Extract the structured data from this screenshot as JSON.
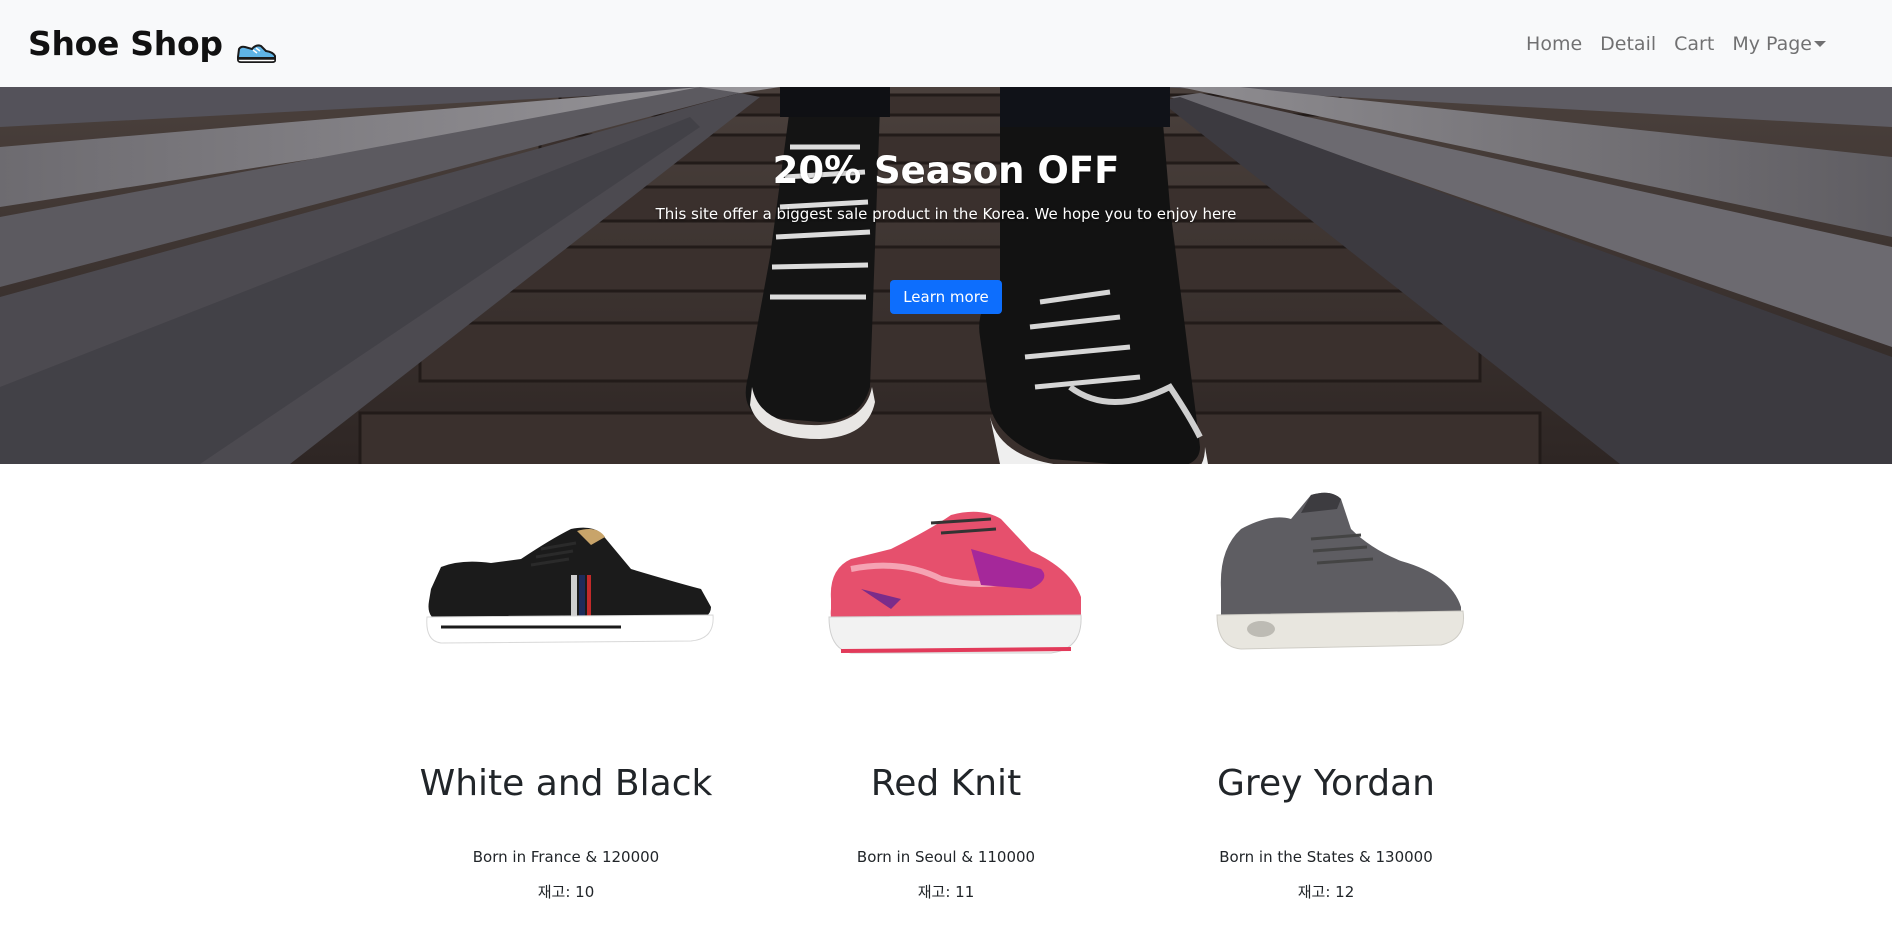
{
  "navbar": {
    "brand": "Shoe Shop",
    "brand_icon": "sneaker-icon",
    "links": [
      "Home",
      "Detail",
      "Cart"
    ],
    "dropdown_label": "My Page"
  },
  "hero": {
    "title": "20% Season OFF",
    "subtitle": "This site offer a biggest sale product in the Korea. We hope you to enjoy here",
    "button_label": "Learn more",
    "button_color": "#0d6efd"
  },
  "products": [
    {
      "name": "White and Black",
      "description": "Born in France & 120000",
      "stock": "재고: 10"
    },
    {
      "name": "Red Knit",
      "description": "Born in Seoul & 110000",
      "stock": "재고: 11"
    },
    {
      "name": "Grey Yordan",
      "description": "Born in the States & 130000",
      "stock": "재고: 12"
    }
  ],
  "colors": {
    "navbar_bg": "#f8f9fa",
    "text": "#212529",
    "nav_link": "rgba(0,0,0,0.55)"
  }
}
